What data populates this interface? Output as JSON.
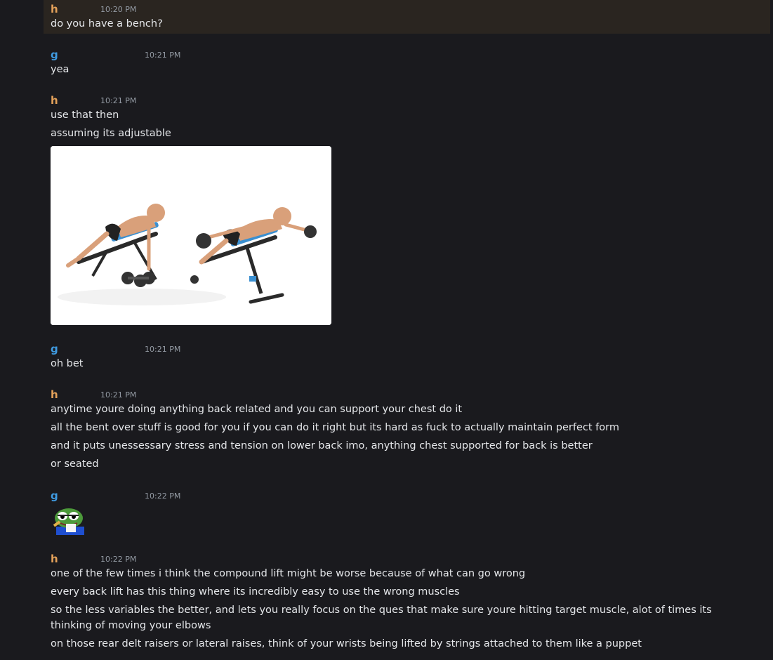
{
  "messages": [
    {
      "author": "h",
      "timestamp": "10:20 PM",
      "lines": [
        "do you have a bench?"
      ]
    },
    {
      "author": "g",
      "timestamp": "10:21 PM",
      "lines": [
        "yea"
      ]
    },
    {
      "author": "h",
      "timestamp": "10:21 PM",
      "lines": [
        "use that then",
        "assuming its adjustable"
      ],
      "attachment": "image-attachment"
    },
    {
      "author": "g",
      "timestamp": "10:21 PM",
      "lines": [
        "oh bet"
      ]
    },
    {
      "author": "h",
      "timestamp": "10:21 PM",
      "lines": [
        "anytime youre doing anything back related and you can support your chest do it",
        "all the bent over stuff is good for you if you can do it right but its hard as fuck to actually maintain perfect form",
        "and it puts unessessary stress and tension on lower back imo, anything chest supported for back is better",
        "or seated"
      ]
    },
    {
      "author": "g",
      "timestamp": "10:22 PM",
      "lines": [],
      "emoji": "frog-emoji"
    },
    {
      "author": "h",
      "timestamp": "10:22 PM",
      "lines": [
        "one of the few times i think the compound lift might be worse because of what can go wrong",
        "every back lift has this thing where its incredibly easy to use the wrong muscles",
        "so the less variables the better, and lets you really focus on the ques that make sure youre hitting target muscle, alot of times its thinking of moving your elbows",
        "on those rear delt raisers or lateral raises, think of your wrists being lifted by strings attached to them like a puppet"
      ]
    }
  ],
  "colors": {
    "background": "#1a1a1e",
    "highlight": "#2a2520",
    "author_h": "#e3a15a",
    "author_g": "#3f9ae0",
    "timestamp": "#949ba4",
    "text": "#e4e6e9"
  }
}
